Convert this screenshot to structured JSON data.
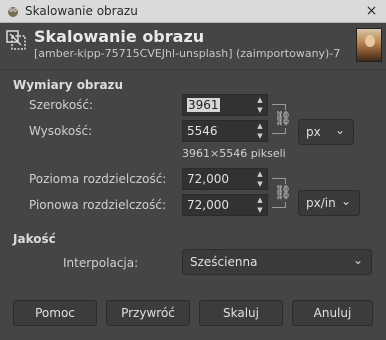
{
  "window": {
    "title": "Skalowanie obrazu",
    "close_glyph": "×",
    "icon": "gimp-wilber-icon"
  },
  "header": {
    "title": "Skalowanie obrazu",
    "subtitle": "[amber-kipp-75715CVEJhl-unsplash] (zaimportowany)-7"
  },
  "dimensions": {
    "section_label": "Wymiary obrazu",
    "width_label": "Szerokość:",
    "width_value": "3961",
    "height_label": "Wysokość:",
    "height_value": "5546",
    "unit": "px",
    "pixel_info": "3961×5546 pikseli",
    "xres_label": "Pozioma rozdzielczość:",
    "xres_value": "72,000",
    "yres_label": "Pionowa rozdzielczość:",
    "yres_value": "72,000",
    "res_unit": "px/in"
  },
  "quality": {
    "section_label": "Jakość",
    "interpolation_label": "Interpolacja:",
    "interpolation_value": "Sześcienna"
  },
  "buttons": {
    "help": "Pomoc",
    "reset": "Przywróć",
    "scale": "Skaluj",
    "cancel": "Anuluj"
  }
}
